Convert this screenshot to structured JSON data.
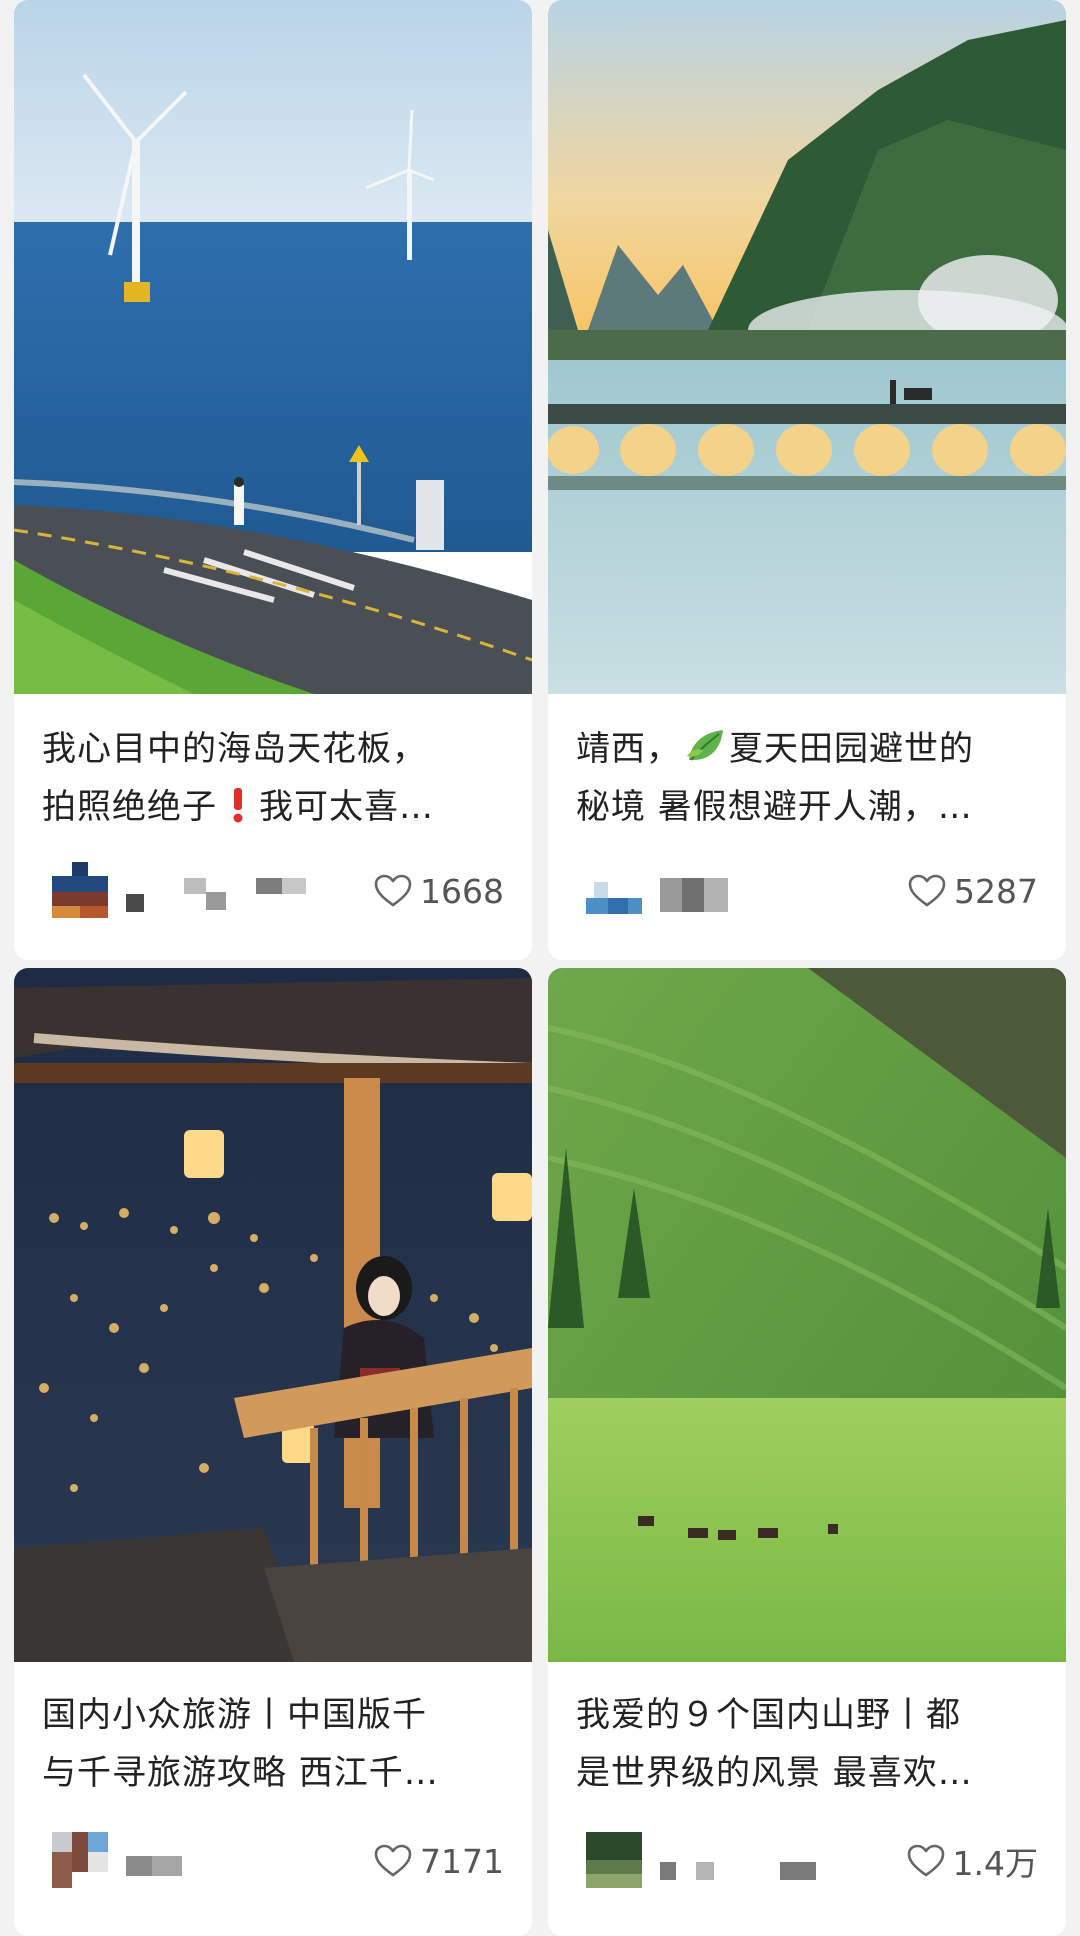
{
  "feed": {
    "posts": [
      {
        "title_line1": "我心目中的海岛天花板，",
        "title_line2_a": "拍照绝绝子",
        "title_line2_b": "我可太喜…",
        "likes": "1668",
        "image": "offshore wind turbines over sea with coastal road",
        "inline_icon": "exclamation-icon"
      },
      {
        "title_line1_a": "靖西，",
        "title_line1_b": "夏天田园避世的",
        "title_line2": "秘境 暑假想避开人潮，…",
        "likes": "5287",
        "image": "misty river with stone arch bridge and karst mountains",
        "inline_icon": "leaf-icon"
      },
      {
        "title_line1": "国内小众旅游丨中国版千",
        "title_line2": "与千寻旅游攻略 西江千…",
        "likes": "7171",
        "image": "woman holding lantern on wooden balcony at night"
      },
      {
        "title_line1": "我爱的９个国内山野丨都",
        "title_line2": "是世界级的风景 最喜欢…",
        "likes": "1.4万",
        "image": "green grassland slopes with grazing horses"
      }
    ]
  },
  "colors": {
    "background": "#f2f2f2",
    "card": "#ffffff",
    "title_text": "#222222",
    "like_text": "#555555",
    "exclamation": "#e0302a"
  }
}
